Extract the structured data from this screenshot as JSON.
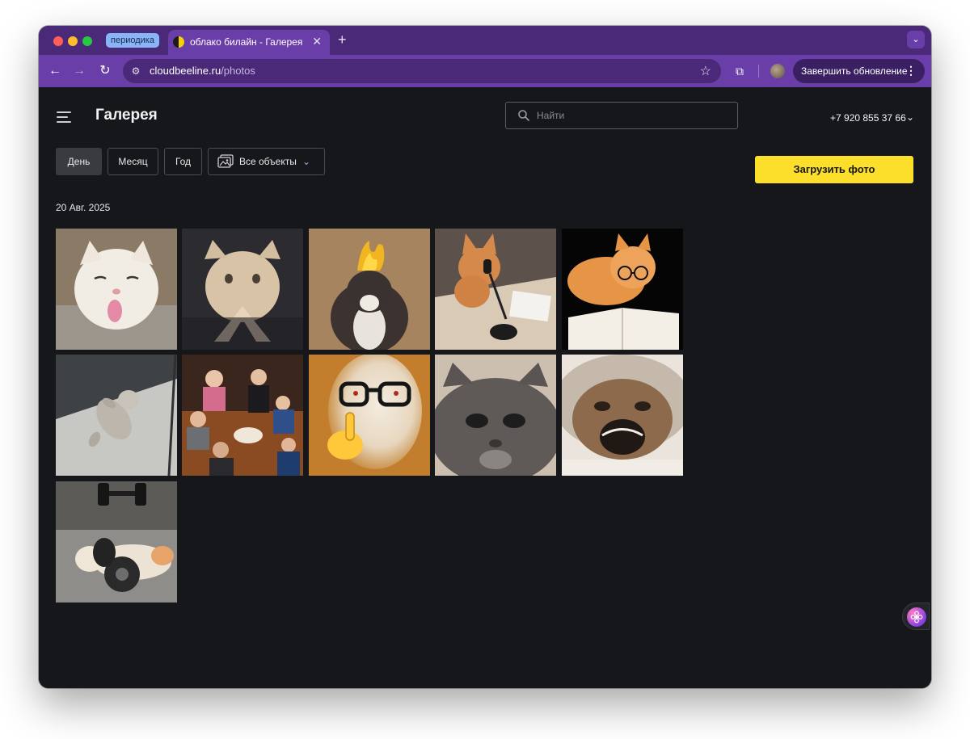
{
  "browser": {
    "tab_group_label": "периодика",
    "tab_title": "облако билайн - Галерея",
    "tab_close": "✕",
    "new_tab": "+",
    "tabs_menu": "⌄",
    "url_host": "cloudbeeline.ru",
    "url_path": "/photos",
    "update_button_label": "Завершить обновление",
    "update_menu": "⋮"
  },
  "header": {
    "title": "Галерея",
    "search_placeholder": "Найти",
    "search_value": "",
    "account_phone": "+7 920 855 37 66"
  },
  "filters": {
    "day": "День",
    "month": "Месяц",
    "year": "Год",
    "all_objects": "Все объекты",
    "active": "day"
  },
  "upload_button": "Загрузить фото",
  "gallery": {
    "date_group": "20 Авг. 2025",
    "photos": [
      {
        "subject": "white cat sticking out tongue"
      },
      {
        "subject": "blurry cat with paws together"
      },
      {
        "subject": "cat with flame on head"
      },
      {
        "subject": "orange cat at microphone desk"
      },
      {
        "subject": "orange cat with glasses reading book"
      },
      {
        "subject": "kitten lying on floor"
      },
      {
        "subject": "group of people sitting on floor"
      },
      {
        "subject": "cat with glasses and pointing finger emoji"
      },
      {
        "subject": "grey cat close-up face"
      },
      {
        "subject": "crying cat close-up"
      },
      {
        "subject": "cat lying with dumbbells"
      }
    ]
  },
  "colors": {
    "accent_yellow": "#fcdf2a",
    "page_background": "#16171b",
    "browser_purple": "#6a3ea8"
  }
}
